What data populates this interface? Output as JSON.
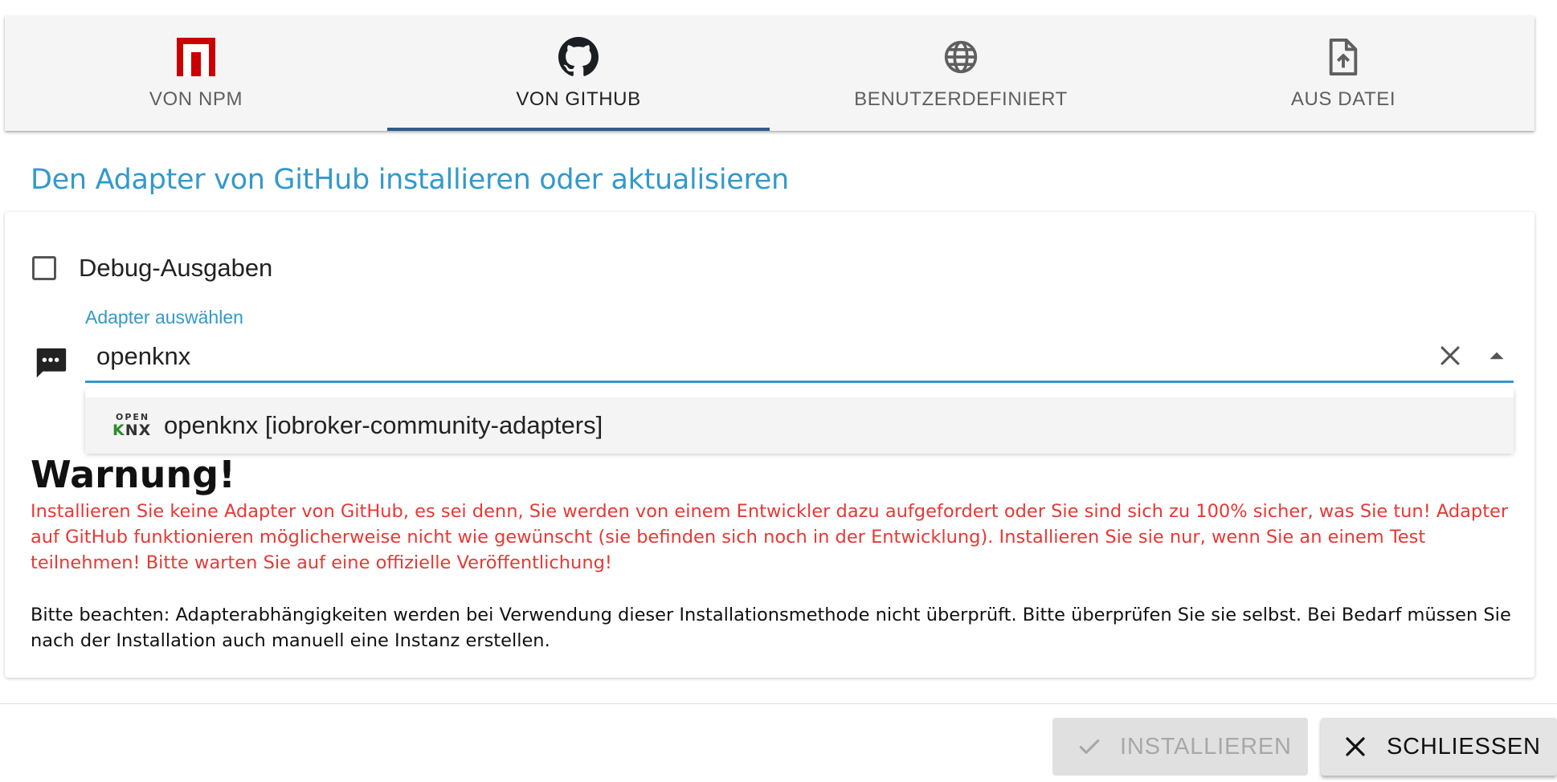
{
  "tabs": [
    {
      "label": "VON NPM",
      "icon": "npm-icon",
      "active": false
    },
    {
      "label": "VON GITHUB",
      "icon": "github-icon",
      "active": true
    },
    {
      "label": "BENUTZERDEFINIERT",
      "icon": "globe-icon",
      "active": false
    },
    {
      "label": "AUS DATEI",
      "icon": "file-upload-icon",
      "active": false
    }
  ],
  "heading": "Den Adapter von GitHub installieren oder aktualisieren",
  "form": {
    "debug_label": "Debug-Ausgaben",
    "debug_checked": false,
    "adapter_label": "Adapter auswählen",
    "adapter_value": "openknx"
  },
  "dropdown": {
    "options": [
      {
        "label": "openknx [iobroker-community-adapters]",
        "logo_top": "OPEN",
        "logo_bottom_k": "K",
        "logo_bottom_nx": "NX"
      }
    ]
  },
  "warning": {
    "title": "Warnung!",
    "text": "Installieren Sie keine Adapter von GitHub, es sei denn, Sie werden von einem Entwickler dazu aufgefordert oder Sie sind sich zu 100% sicher, was Sie tun! Adapter auf GitHub funktionieren möglicherweise nicht wie gewünscht (sie befinden sich noch in der Entwicklung). Installieren Sie sie nur, wenn Sie an einem Test teilnehmen! Bitte warten Sie auf eine offizielle Veröffentlichung!",
    "note": "Bitte beachten: Adapterabhängigkeiten werden bei Verwendung dieser Installationsmethode nicht überprüft. Bitte überprüfen Sie sie selbst. Bei Bedarf müssen Sie nach der Installation auch manuell eine Instanz erstellen."
  },
  "footer": {
    "install_label": "INSTALLIEREN",
    "install_enabled": false,
    "close_label": "SCHLIESSEN"
  },
  "colors": {
    "accent": "#3399cc",
    "tab_indicator": "#2f5b8f",
    "warning": "#e53935",
    "npm_red": "#cb0000"
  }
}
